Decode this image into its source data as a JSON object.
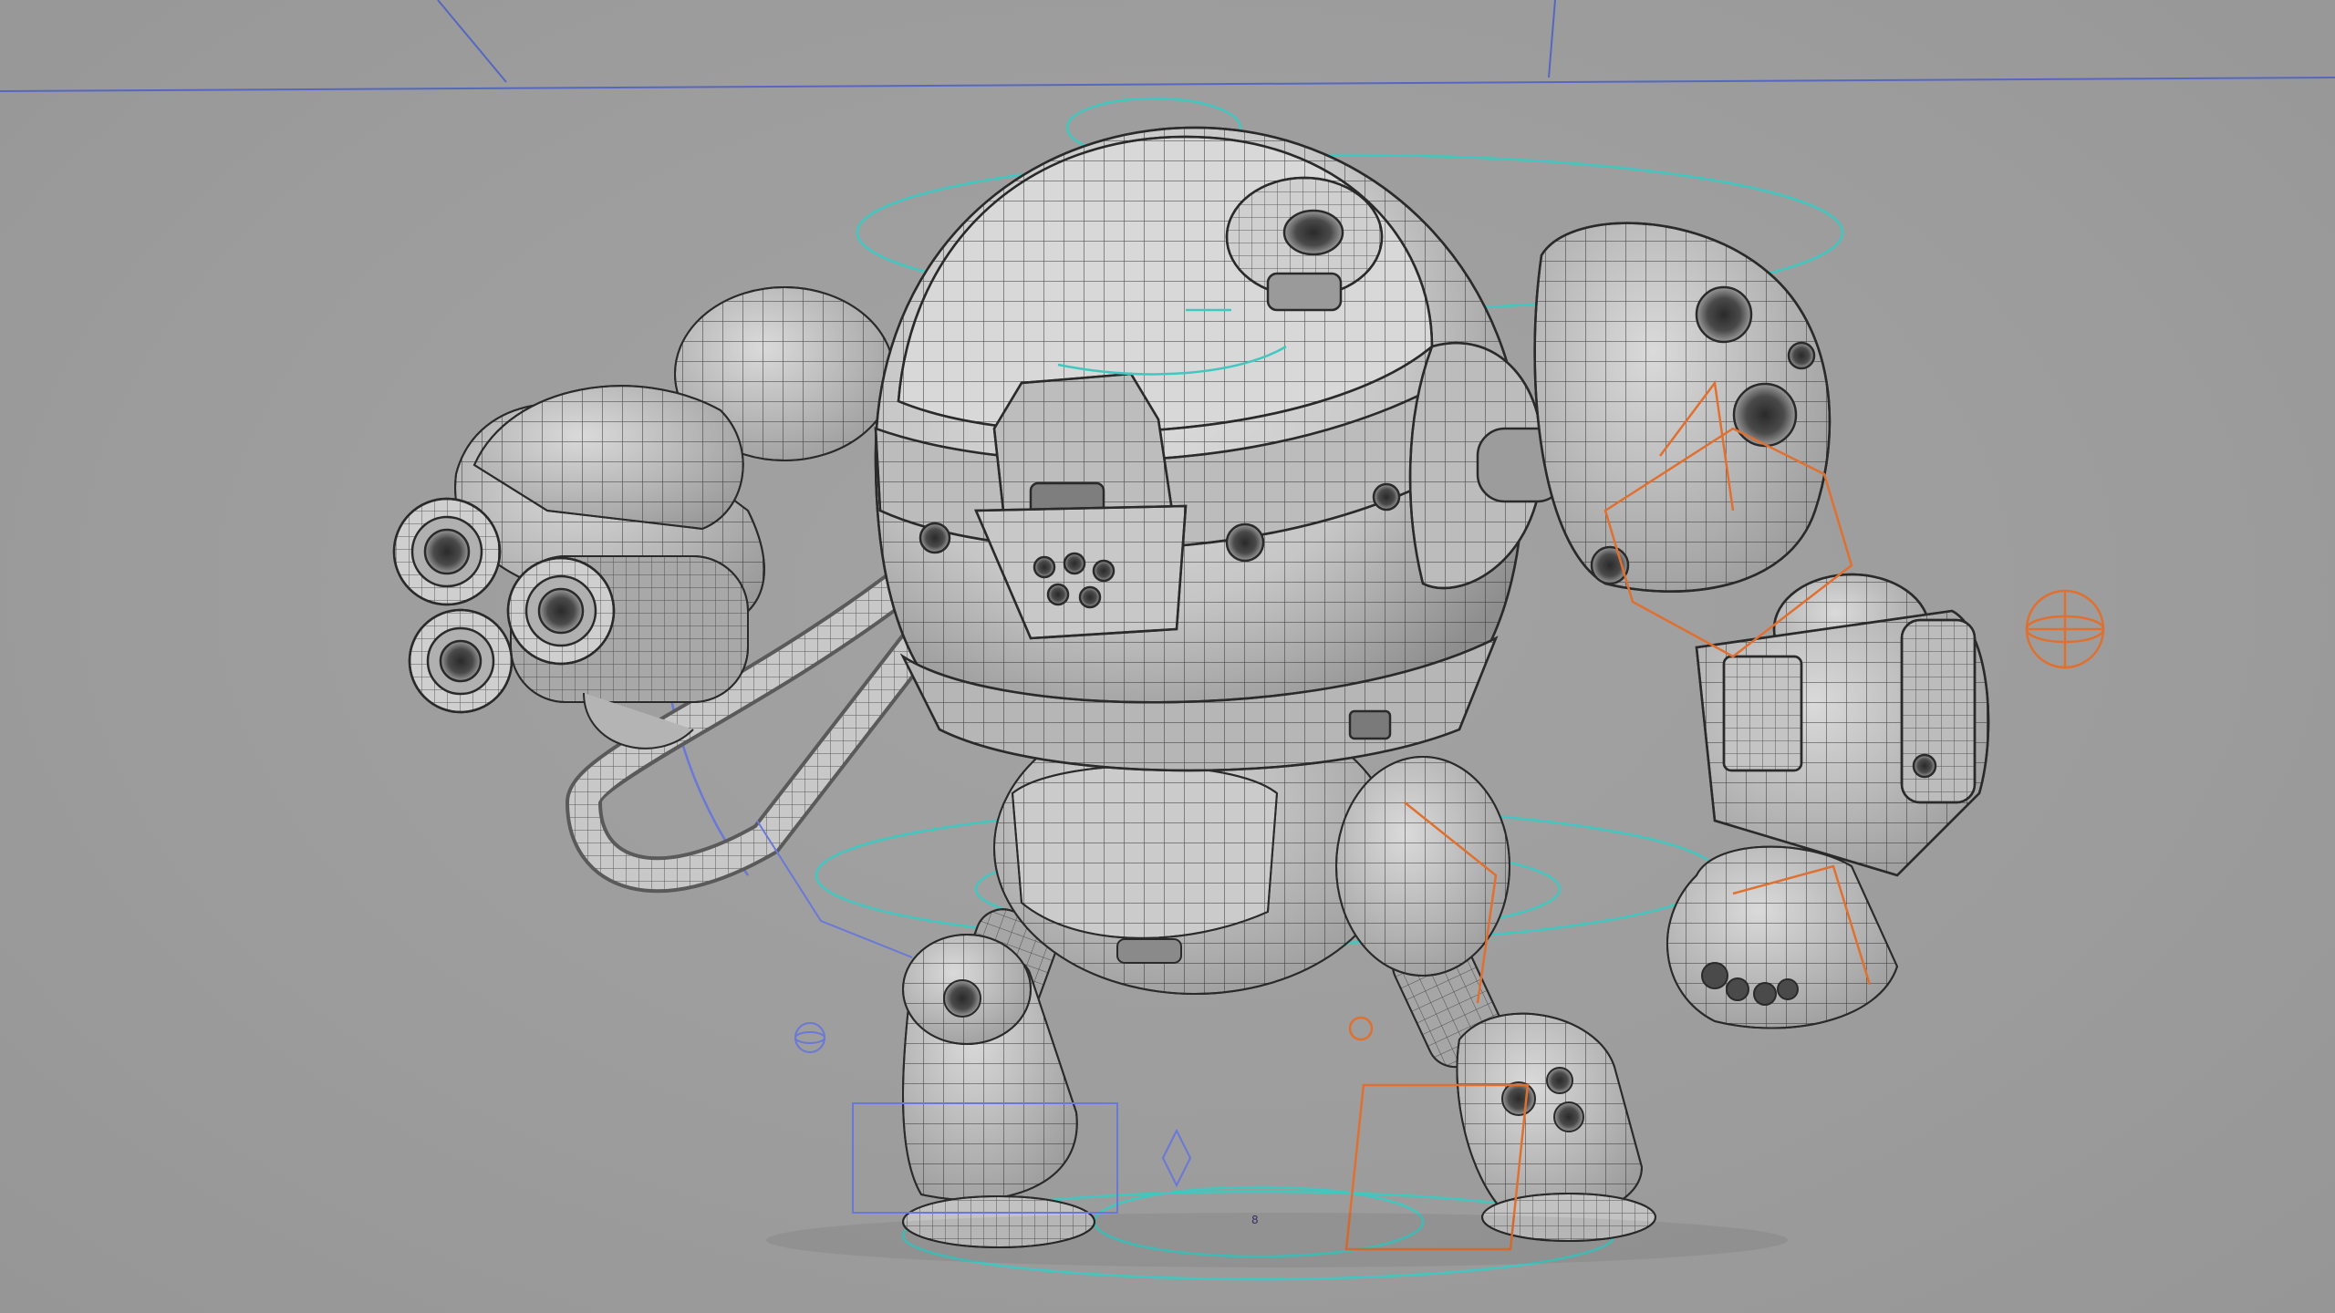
{
  "viewport": {
    "background": "#9c9c9c",
    "frame_marker": "8"
  },
  "colors": {
    "wire": "#2a2a2a",
    "surface_light": "#dcdcdc",
    "surface_mid": "#c4c4c4",
    "surface_dark": "#8e8e8e",
    "ctrl_cyan": "#40c8c0",
    "ctrl_orange": "#e07030",
    "ctrl_blue": "#6a78d8",
    "grid_line": "#4a5ec8"
  },
  "icons": [
    "joint-ball-icon",
    "locator-icon",
    "diamond-control-icon"
  ]
}
